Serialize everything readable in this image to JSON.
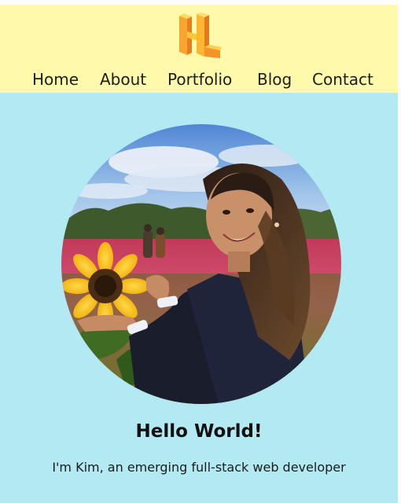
{
  "header": {
    "logo_icon": "hl-monogram-logo",
    "nav": [
      {
        "label": "Home"
      },
      {
        "label": "About"
      },
      {
        "label": "Portfolio"
      },
      {
        "label": "Blog"
      },
      {
        "label": "Contact"
      }
    ]
  },
  "hero": {
    "photo": "portrait-with-sunflower",
    "title": "Hello World!",
    "subtitle": "I'm Kim, an emerging full-stack web developer"
  },
  "colors": {
    "header_bg": "#fff9ab",
    "hero_bg": "#b2e9f2",
    "logo_orange": "#f49a2b",
    "logo_yellow": "#ffd23d"
  }
}
